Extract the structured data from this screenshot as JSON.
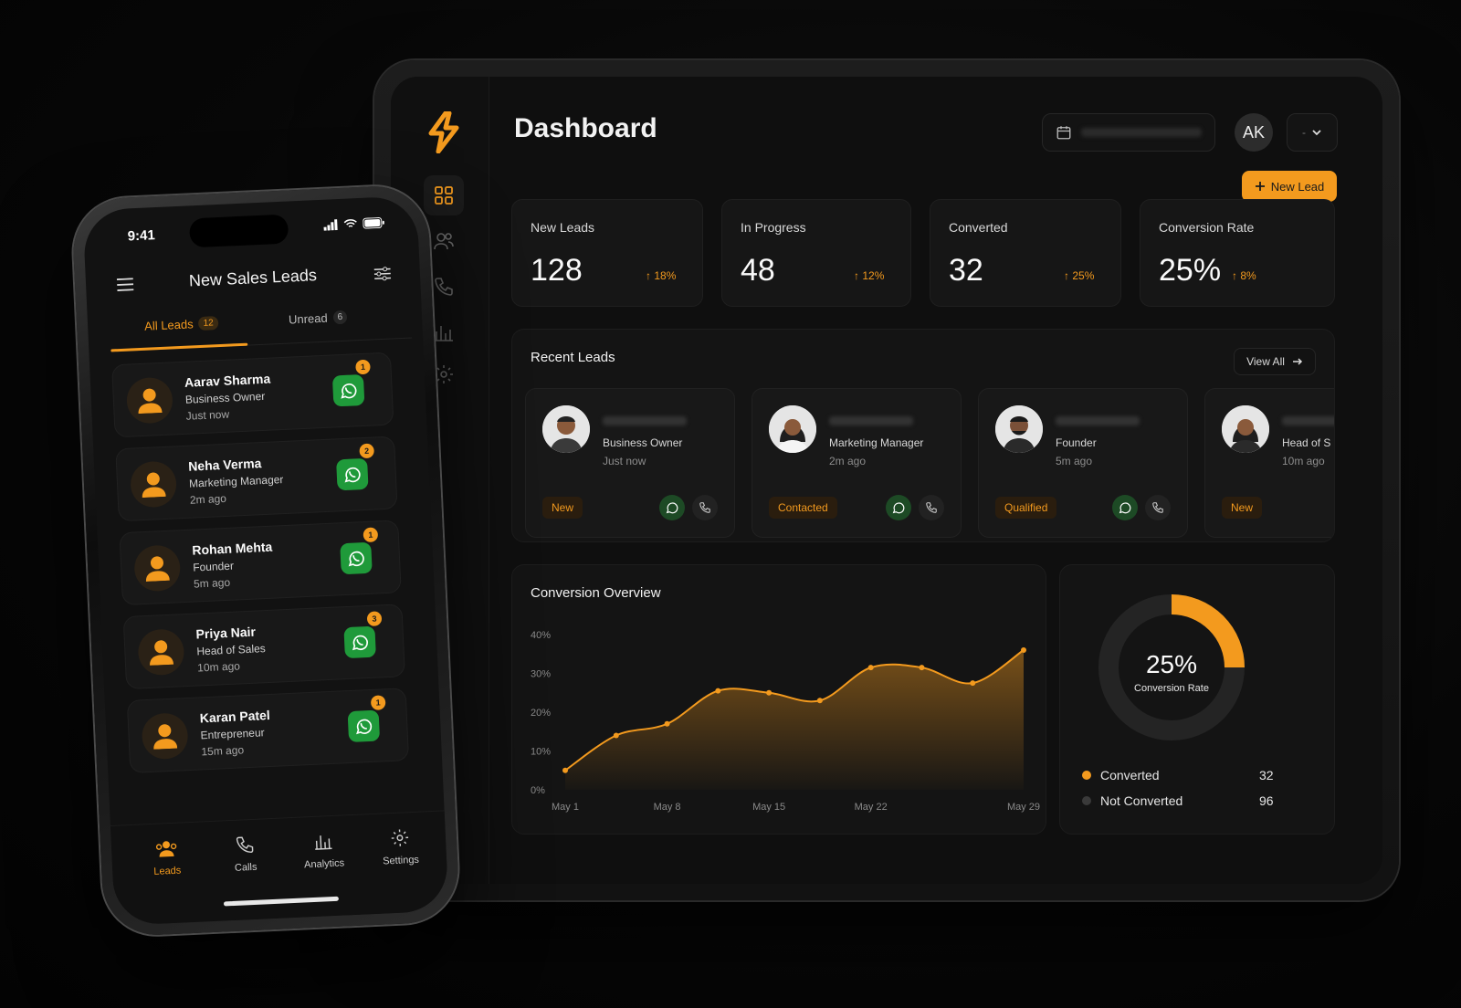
{
  "colors": {
    "accent": "#f39a1e",
    "whatsapp": "#1f9a3a",
    "background": "#0a0a0a",
    "not_converted": "#3a3a3a"
  },
  "tablet": {
    "title": "Dashboard",
    "avatar_initials": "AK",
    "user_menu_label": "-",
    "new_lead_label": "New Lead",
    "sidebar_icons": [
      "dashboard-icon",
      "users-icon",
      "phone-icon",
      "analytics-icon",
      "settings-icon"
    ],
    "stats": [
      {
        "label": "New Leads",
        "value": "128",
        "delta": "18%"
      },
      {
        "label": "In Progress",
        "value": "48",
        "delta": "12%"
      },
      {
        "label": "Converted",
        "value": "32",
        "delta": "25%"
      },
      {
        "label": "Conversion Rate",
        "value": "25%",
        "delta": "8%"
      }
    ],
    "recent_leads": {
      "title": "Recent Leads",
      "view_all": "View All",
      "items": [
        {
          "role": "Business Owner",
          "time": "Just now",
          "status": "New"
        },
        {
          "role": "Marketing Manager",
          "time": "2m ago",
          "status": "Contacted"
        },
        {
          "role": "Founder",
          "time": "5m ago",
          "status": "Qualified"
        },
        {
          "role": "Head of S",
          "time": "10m ago",
          "status": "New"
        }
      ]
    },
    "conversion_overview": {
      "title": "Conversion Overview"
    },
    "donut": {
      "value_label": "25%",
      "caption": "Conversion Rate",
      "fraction": 0.25,
      "legend": [
        {
          "label": "Converted",
          "value": "32"
        },
        {
          "label": "Not Converted",
          "value": "96"
        }
      ]
    }
  },
  "chart_data": {
    "type": "area",
    "title": "Conversion Overview",
    "x": [
      "May 1",
      "May 4",
      "May 8",
      "May 12",
      "May 15",
      "May 18",
      "May 22",
      "May 23",
      "May 26",
      "May 29"
    ],
    "x_tick_labels": [
      "May 1",
      "May 8",
      "May 15",
      "May 22",
      "May 29"
    ],
    "series": [
      {
        "values": [
          5,
          14,
          17,
          25.5,
          25,
          23,
          31.5,
          31.5,
          27.5,
          36
        ]
      }
    ],
    "y_tick_labels": [
      "0%",
      "10%",
      "20%",
      "30%",
      "40%"
    ],
    "ylim": [
      0,
      40
    ],
    "grid": false
  },
  "phone": {
    "time": "9:41",
    "title": "New Sales Leads",
    "tabs": [
      {
        "label": "All Leads",
        "count": "12"
      },
      {
        "label": "Unread",
        "count": "6"
      }
    ],
    "leads": [
      {
        "name": "Aarav Sharma",
        "role": "Business Owner",
        "time": "Just now",
        "badge": "1"
      },
      {
        "name": "Neha Verma",
        "role": "Marketing Manager",
        "time": "2m ago",
        "badge": "2"
      },
      {
        "name": "Rohan Mehta",
        "role": "Founder",
        "time": "5m ago",
        "badge": "1"
      },
      {
        "name": "Priya Nair",
        "role": "Head of Sales",
        "time": "10m ago",
        "badge": "3"
      },
      {
        "name": "Karan Patel",
        "role": "Entrepreneur",
        "time": "15m ago",
        "badge": "1"
      }
    ],
    "nav": [
      {
        "label": "Leads",
        "icon": "leads-icon"
      },
      {
        "label": "Calls",
        "icon": "phone-icon"
      },
      {
        "label": "Analytics",
        "icon": "analytics-icon"
      },
      {
        "label": "Settings",
        "icon": "settings-icon"
      }
    ]
  }
}
